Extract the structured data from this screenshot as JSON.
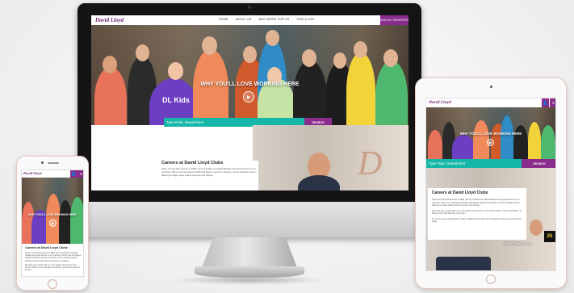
{
  "site": {
    "logo": "David Lloyd",
    "nav": [
      "HOME",
      "ABOUT US",
      "WHY WORK FOR US",
      "FIND A JOB"
    ],
    "join_label": "SIGN IN / REGISTER",
    "hero_title": "WHY YOU'LL LOVE WORKING HERE",
    "shirt_text": "DL Kids",
    "search_placeholder": "Type Role, Department",
    "search_button": "SEARCH",
    "careers_title": "Careers at David Lloyd Clubs",
    "careers_text": "Since our first club opened in 1982, we've provided unrivalled facilities and great service to our members. We're now the largest health and fitness operator in Europe, but we still take pride in offering a unique place where everyone can belong.",
    "careers_text_2": "We want you to grow with us, to be people who love fit, to be who're health. If you're already in to family, you'll love this part of the job.",
    "careers_text_3": "So, if you've got the passion to make a difference through our employees to find your perfect job today.",
    "quote_name": "Glenn Earlam, CEO",
    "phone_hero_title": "WHY YOU'LL LOVE WORKING HERE",
    "badge_number": "25"
  },
  "colors": {
    "brand_purple": "#8a2c8d",
    "teal": "#14b7a8",
    "logo": "#6b1f6d"
  },
  "icons": {
    "user": "user-icon",
    "menu": "menu-icon",
    "play": "play-icon"
  }
}
